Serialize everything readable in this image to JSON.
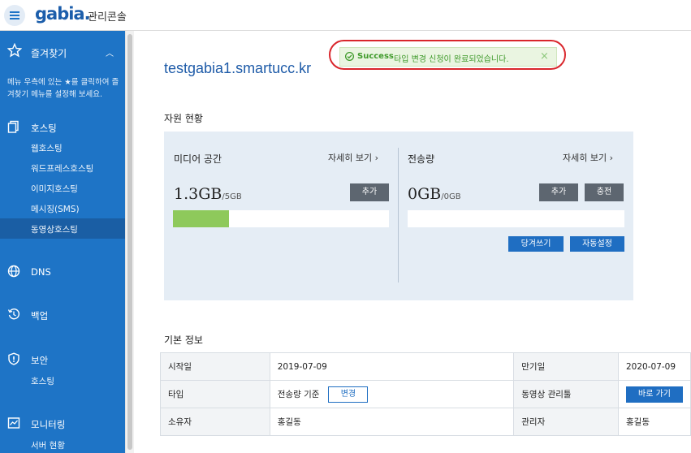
{
  "header": {
    "logo": "gabia.",
    "console": "관리콘솔"
  },
  "sidebar": {
    "favorites": {
      "label": "즐겨찾기",
      "desc": "메뉴 우측에 있는 ★를 클릭하여 즐겨찾기 메뉴를 설정해 보세요."
    },
    "hosting": {
      "label": "호스팅",
      "items": [
        "웹호스팅",
        "워드프레스호스팅",
        "이미지호스팅",
        "메시징(SMS)",
        "동영상호스팅"
      ]
    },
    "dns": {
      "label": "DNS"
    },
    "backup": {
      "label": "백업"
    },
    "security": {
      "label": "보안",
      "items": [
        "호스팅"
      ]
    },
    "monitoring": {
      "label": "모니터링",
      "items": [
        "서버 현황"
      ]
    }
  },
  "toast": {
    "status": "Success",
    "message": "타입 변경 신청이 완료되었습니다.",
    "close": "×"
  },
  "domain": "testgabia1.smartucc.kr",
  "resources": {
    "title": "자원 현황",
    "media": {
      "title": "미디어 공간",
      "detail": "자세히 보기 ›",
      "used": "1.3GB",
      "total": "/5GB",
      "add": "추가",
      "usage_fraction": 0.26
    },
    "traffic": {
      "title": "전송량",
      "detail": "자세히 보기 ›",
      "used": "0GB",
      "total": "/0GB",
      "add": "추가",
      "charge": "충전",
      "pull": "당겨쓰기",
      "auto": "자동설정",
      "usage_fraction": 0
    }
  },
  "info": {
    "title": "기본 정보",
    "start_label": "시작일",
    "start": "2019-07-09",
    "expire_label": "만기일",
    "expire": "2020-07-09",
    "type_label": "타입",
    "type": "전송량 기준",
    "change": "변경",
    "video_label": "동영상 관리툴",
    "go": "바로 가기",
    "owner_label": "소유자",
    "owner": "홍길동",
    "admin_label": "관리자",
    "admin": "홍길동"
  },
  "colors": {
    "accent": "#1e74c6",
    "success": "#3f9a2b",
    "highlight": "#d9262c"
  }
}
